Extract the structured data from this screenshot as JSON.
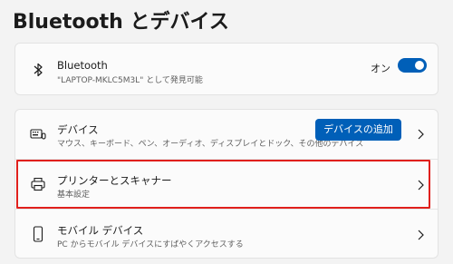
{
  "page": {
    "title": "Bluetooth とデバイス"
  },
  "bluetooth": {
    "icon": "bluetooth-icon",
    "title": "Bluetooth",
    "subtitle": "\"LAPTOP-MKLC5M3L\" として発見可能",
    "toggle_label": "オン",
    "toggle_on": true
  },
  "list": {
    "devices": {
      "icon": "keyboard-mouse-icon",
      "title": "デバイス",
      "subtitle": "マウス、キーボード、ペン、オーディオ、ディスプレイとドック、その他のデバイス",
      "button_label": "デバイスの追加"
    },
    "printers": {
      "icon": "printer-icon",
      "title": "プリンターとスキャナー",
      "subtitle": "基本設定"
    },
    "mobile": {
      "icon": "phone-icon",
      "title": "モバイル デバイス",
      "subtitle": "PC からモバイル デバイスにすばやくアクセスする"
    }
  },
  "colors": {
    "accent": "#005fb8",
    "highlight": "#e0201c",
    "background": "#f3f3f3"
  }
}
